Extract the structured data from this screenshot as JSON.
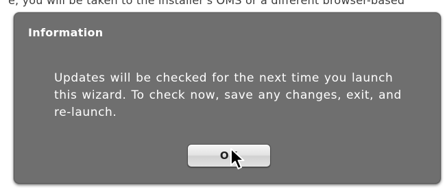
{
  "background_text": "e, you will be taken to the installer's OMS or a different browser-based",
  "dialog": {
    "title": "Information",
    "message": "Updates will be checked for the next time you launch this wizard.  To check now, save any changes, exit, and re-launch.",
    "ok_label": "OK"
  },
  "icons": {
    "cursor": "mouse-pointer-icon"
  },
  "colors": {
    "dialog_background": "#6f6f6f",
    "text": "#ffffff",
    "button_face": "#e5e5e5"
  }
}
